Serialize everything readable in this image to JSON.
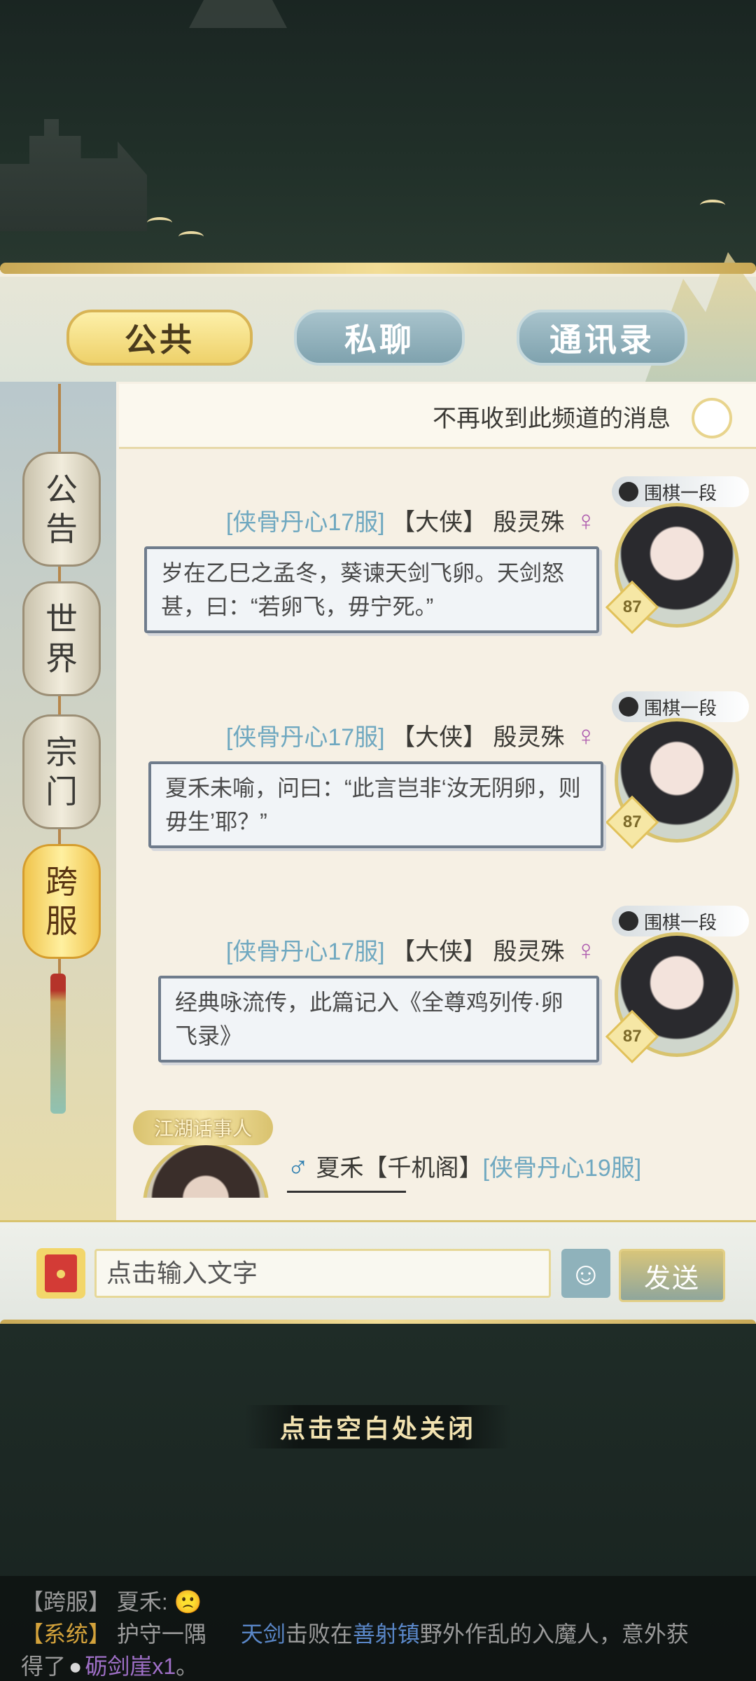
{
  "tabs": {
    "public": "公共",
    "private": "私聊",
    "contacts": "通讯录"
  },
  "mute": {
    "label": "不再收到此频道的消息"
  },
  "channels": [
    {
      "c1": "公",
      "c2": "告"
    },
    {
      "c1": "世",
      "c2": "界"
    },
    {
      "c1": "宗",
      "c2": "门"
    },
    {
      "c1": "跨",
      "c2": "服"
    }
  ],
  "messages": [
    {
      "server": "[侠骨丹心17服]",
      "title": "【大侠】",
      "name": "殷灵殊",
      "badge": "围棋一段",
      "level": "87",
      "text": "岁在乙巳之孟冬，葵谏天剑飞卵。天剑怒甚，曰：“若卵飞，毋宁死。”"
    },
    {
      "server": "[侠骨丹心17服]",
      "title": "【大侠】",
      "name": "殷灵殊",
      "badge": "围棋一段",
      "level": "87",
      "text": "夏禾未喻，问曰：“此言岂非‘汝无阴卵，则毋生’耶？”"
    },
    {
      "server": "[侠骨丹心17服]",
      "title": "【大侠】",
      "name": "殷灵殊",
      "badge": "围棋一段",
      "level": "87",
      "text": "经典咏流传，此篇记入《全尊鸡列传·卵飞录》"
    }
  ],
  "last_message": {
    "badge": "江湖话事人",
    "name": "夏禾",
    "title": "【千机阁】",
    "server": "[侠骨丹心19服]"
  },
  "input": {
    "placeholder": "点击输入文字",
    "send": "发送",
    "emoji_icon": "smile-icon",
    "redpacket_icon": "red-packet-icon"
  },
  "close_hint": "点击空白处关闭",
  "ticker": {
    "line1_tag": "【跨服】",
    "line1_name": "夏禾:",
    "line2_tag": "【系统】",
    "line2_a": "护守一隅",
    "line2_b": "天剑",
    "line2_c": "击败在",
    "line2_d": "善射镇",
    "line2_e": "野外作乱的入魔人，意外获",
    "line3_a": "得了",
    "line3_b": "砺剑崖x1",
    "line3_c": "。"
  },
  "colors": {
    "gold": "#d3a23b",
    "server_blue": "#6fa8c0",
    "female": "#b060b0",
    "male": "#2f7fb0"
  }
}
